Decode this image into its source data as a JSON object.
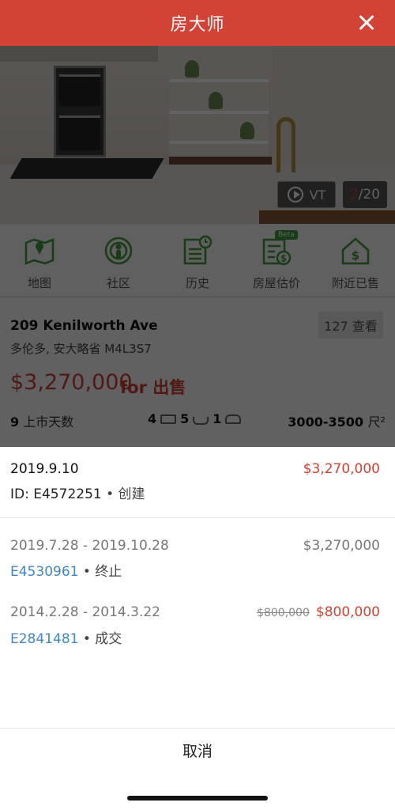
{
  "header": {
    "title": "房大师"
  },
  "photo": {
    "vt_label": "VT",
    "photo_current": "2",
    "photo_total": "/20"
  },
  "nav_icons": [
    {
      "label": "地图",
      "icon": "map-icon"
    },
    {
      "label": "社区",
      "icon": "community-icon"
    },
    {
      "label": "历史",
      "icon": "history-icon"
    },
    {
      "label": "房屋估价",
      "icon": "valuation-icon",
      "badge": "Beta"
    },
    {
      "label": "附近已售",
      "icon": "nearby-sold-icon"
    }
  ],
  "listing": {
    "address": "209 Kenilworth Ave",
    "city": "多伦多, 安大略省 M4L3S7",
    "views": "127 查看",
    "price": "$3,270,000",
    "status": "for 出售",
    "days_on_market": "9",
    "days_label": "上市天数",
    "beds": "4",
    "baths": "5",
    "parking": "1",
    "sqft": "3000-3500",
    "sqft_unit": "尺²"
  },
  "history": [
    {
      "date": "2019.9.10",
      "price": "$3,270,000",
      "price_color": "#d24235",
      "id_prefix": "ID: ",
      "mls": "E4572251",
      "sep": " • ",
      "action": "创建"
    },
    {
      "date": "2019.7.28 - 2019.10.28",
      "price": "$3,270,000",
      "mls": "E4530961",
      "sep": " • ",
      "action": "终止"
    },
    {
      "date": "2014.2.28 - 2014.3.22",
      "old_price": "$800,000",
      "price": "$800,000",
      "price_color": "#d24235",
      "mls": "E2841481",
      "sep": " • ",
      "action": "成交"
    }
  ],
  "sheet": {
    "cancel_label": "取消"
  },
  "colors": {
    "brand": "#d24235",
    "link": "#3f86c6"
  }
}
